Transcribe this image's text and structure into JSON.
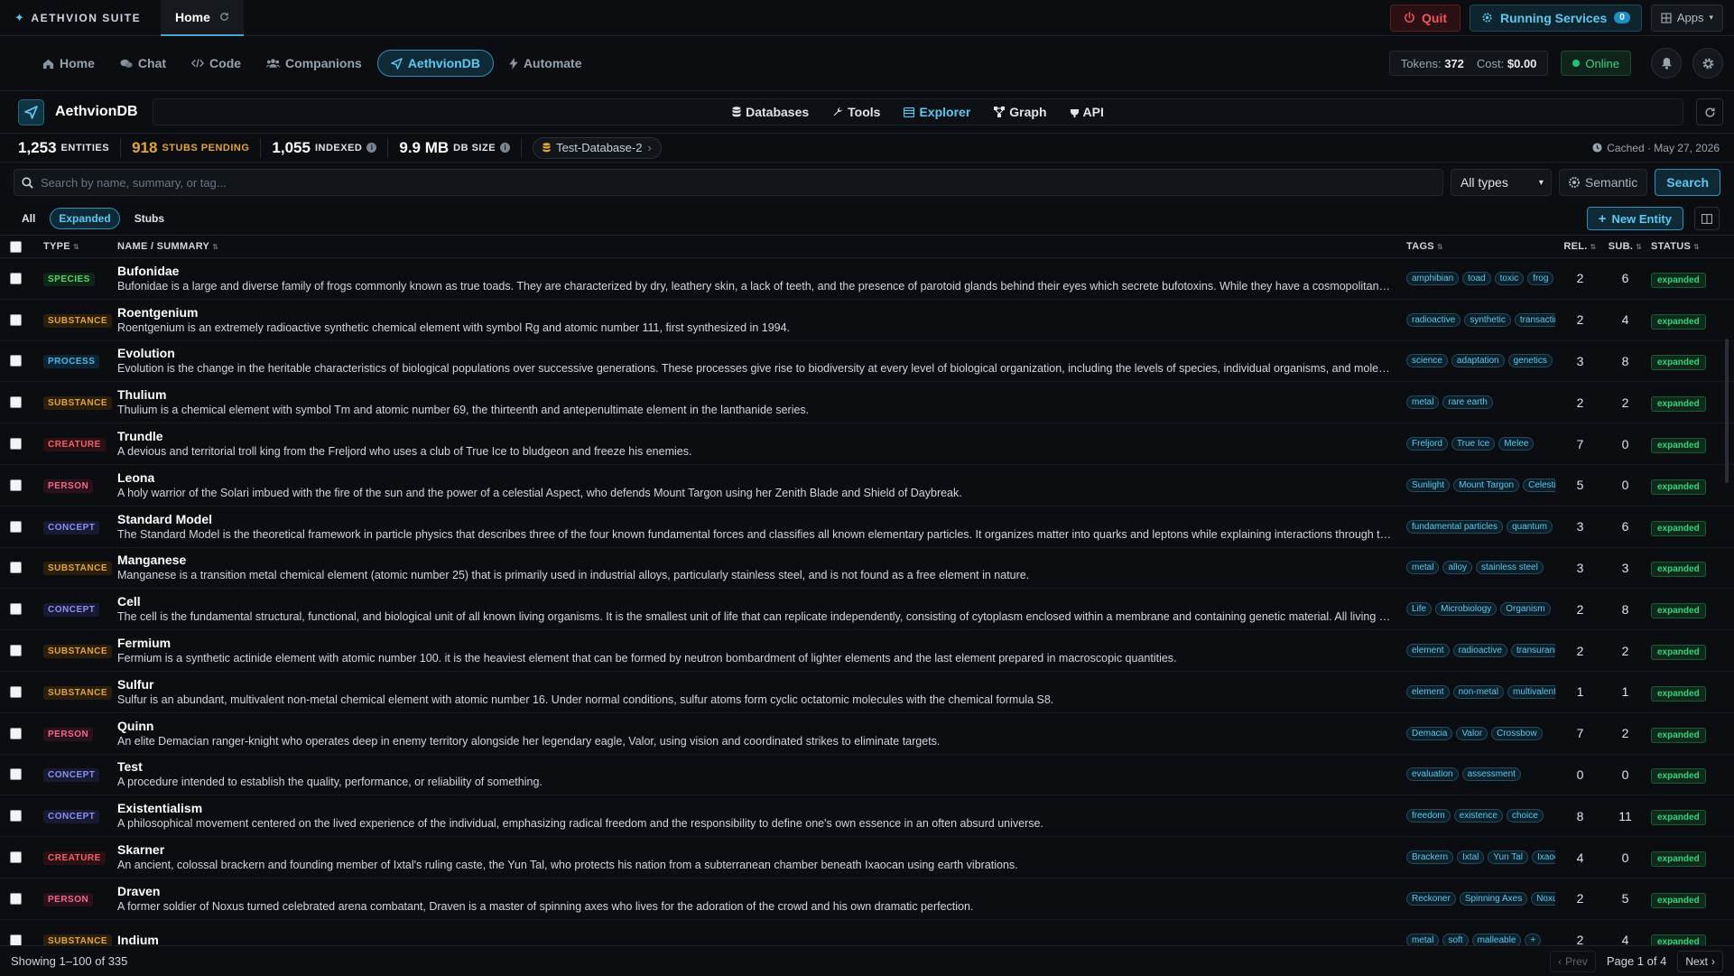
{
  "topbar": {
    "brand": "AETHVION SUITE",
    "tab_label": "Home",
    "quit_label": "Quit",
    "running_services_label": "Running Services",
    "running_services_count": "0",
    "apps_label": "Apps"
  },
  "nav": {
    "items": [
      {
        "label": "Home",
        "icon": "house-icon"
      },
      {
        "label": "Chat",
        "icon": "chat-icon"
      },
      {
        "label": "Code",
        "icon": "code-icon"
      },
      {
        "label": "Companions",
        "icon": "users-icon"
      },
      {
        "label": "AethvionDB",
        "icon": "send-icon"
      },
      {
        "label": "Automate",
        "icon": "bolt-icon"
      }
    ],
    "active": "AethvionDB",
    "tokens_label": "Tokens:",
    "tokens_value": "372",
    "cost_label": "Cost:",
    "cost_value": "$0.00",
    "status": "Online"
  },
  "db_header": {
    "title": "AethvionDB",
    "tabs": [
      "Databases",
      "Tools",
      "Explorer",
      "Graph",
      "API"
    ],
    "active_tab": "Explorer"
  },
  "metrics": {
    "entities_value": "1,253",
    "entities_label": "ENTITIES",
    "stubs_value": "918",
    "stubs_label": "STUBS PENDING",
    "indexed_value": "1,055",
    "indexed_label": "INDEXED",
    "size_value": "9.9 MB",
    "size_label": "DB SIZE",
    "database": "Test-Database-2",
    "cached": "Cached · May 27, 2026"
  },
  "search": {
    "placeholder": "Search by name, summary, or tag...",
    "type_filter": "All types",
    "semantic_label": "Semantic",
    "search_label": "Search"
  },
  "filters": {
    "pills": [
      "All",
      "Expanded",
      "Stubs"
    ],
    "active": "Expanded",
    "new_entity_label": "New Entity"
  },
  "table": {
    "headers": {
      "type": "TYPE",
      "name": "NAME / SUMMARY",
      "tags": "TAGS",
      "rel": "REL.",
      "sub": "SUB.",
      "status": "STATUS"
    },
    "rows": [
      {
        "type": "SPECIES",
        "name": "Bufonidae",
        "summary": "Bufonidae is a large and diverse family of frogs commonly known as true toads. They are characterized by dry, leathery skin, a lack of teeth, and the presence of parotoid glands behind their eyes which secrete bufotoxins. While they have a cosmopolitan distribution",
        "tags": [
          "amphibian",
          "toad",
          "toxic",
          "frog"
        ],
        "rel": "2",
        "sub": "6",
        "status": "expanded"
      },
      {
        "type": "SUBSTANCE",
        "name": "Roentgenium",
        "summary": "Roentgenium is an extremely radioactive synthetic chemical element with symbol Rg and atomic number 111, first synthesized in 1994.",
        "tags": [
          "radioactive",
          "synthetic",
          "transactinide"
        ],
        "rel": "2",
        "sub": "4",
        "status": "expanded"
      },
      {
        "type": "PROCESS",
        "name": "Evolution",
        "summary": "Evolution is the change in the heritable characteristics of biological populations over successive generations. These processes give rise to biodiversity at every level of biological organization, including the levels of species, individual organisms, and molecules",
        "tags": [
          "science",
          "adaptation",
          "genetics"
        ],
        "rel": "3",
        "sub": "8",
        "status": "expanded"
      },
      {
        "type": "SUBSTANCE",
        "name": "Thulium",
        "summary": "Thulium is a chemical element with symbol Tm and atomic number 69, the thirteenth and antepenultimate element in the lanthanide series.",
        "tags": [
          "metal",
          "rare earth"
        ],
        "rel": "2",
        "sub": "2",
        "status": "expanded"
      },
      {
        "type": "CREATURE",
        "name": "Trundle",
        "summary": "A devious and territorial troll king from the Freljord who uses a club of True Ice to bludgeon and freeze his enemies.",
        "tags": [
          "Freljord",
          "True Ice",
          "Melee"
        ],
        "rel": "7",
        "sub": "0",
        "status": "expanded"
      },
      {
        "type": "PERSON",
        "name": "Leona",
        "summary": "A holy warrior of the Solari imbued with the fire of the sun and the power of a celestial Aspect, who defends Mount Targon using her Zenith Blade and Shield of Daybreak.",
        "tags": [
          "Sunlight",
          "Mount Targon",
          "Celestial"
        ],
        "rel": "5",
        "sub": "0",
        "status": "expanded"
      },
      {
        "type": "CONCEPT",
        "name": "Standard Model",
        "summary": "The Standard Model is the theoretical framework in particle physics that describes three of the four known fundamental forces and classifies all known elementary particles. It organizes matter into quarks and leptons while explaining interactions through the exchange",
        "tags": [
          "fundamental particles",
          "quantum"
        ],
        "rel": "3",
        "sub": "6",
        "status": "expanded"
      },
      {
        "type": "SUBSTANCE",
        "name": "Manganese",
        "summary": "Manganese is a transition metal chemical element (atomic number 25) that is primarily used in industrial alloys, particularly stainless steel, and is not found as a free element in nature.",
        "tags": [
          "metal",
          "alloy",
          "stainless steel"
        ],
        "rel": "3",
        "sub": "3",
        "status": "expanded"
      },
      {
        "type": "CONCEPT",
        "name": "Cell",
        "summary": "The cell is the fundamental structural, functional, and biological unit of all known living organisms. It is the smallest unit of life that can replicate independently, consisting of cytoplasm enclosed within a membrane and containing genetic material. All living things",
        "tags": [
          "Life",
          "Microbiology",
          "Organism"
        ],
        "rel": "2",
        "sub": "8",
        "status": "expanded"
      },
      {
        "type": "SUBSTANCE",
        "name": "Fermium",
        "summary": "Fermium is a synthetic actinide element with atomic number 100. it is the heaviest element that can be formed by neutron bombardment of lighter elements and the last element prepared in macroscopic quantities.",
        "tags": [
          "element",
          "radioactive",
          "transuranic"
        ],
        "rel": "2",
        "sub": "2",
        "status": "expanded"
      },
      {
        "type": "SUBSTANCE",
        "name": "Sulfur",
        "summary": "Sulfur is an abundant, multivalent non-metal chemical element with atomic number 16. Under normal conditions, sulfur atoms form cyclic octatomic molecules with the chemical formula S8.",
        "tags": [
          "element",
          "non-metal",
          "multivalent"
        ],
        "rel": "1",
        "sub": "1",
        "status": "expanded"
      },
      {
        "type": "PERSON",
        "name": "Quinn",
        "summary": "An elite Demacian ranger-knight who operates deep in enemy territory alongside her legendary eagle, Valor, using vision and coordinated strikes to eliminate targets.",
        "tags": [
          "Demacia",
          "Valor",
          "Crossbow"
        ],
        "rel": "7",
        "sub": "2",
        "status": "expanded"
      },
      {
        "type": "CONCEPT",
        "name": "Test",
        "summary": "A procedure intended to establish the quality, performance, or reliability of something.",
        "tags": [
          "evaluation",
          "assessment"
        ],
        "rel": "0",
        "sub": "0",
        "status": "expanded"
      },
      {
        "type": "CONCEPT",
        "name": "Existentialism",
        "summary": "A philosophical movement centered on the lived experience of the individual, emphasizing radical freedom and the responsibility to define one's own essence in an often absurd universe.",
        "tags": [
          "freedom",
          "existence",
          "choice"
        ],
        "rel": "8",
        "sub": "11",
        "status": "expanded"
      },
      {
        "type": "CREATURE",
        "name": "Skarner",
        "summary": "An ancient, colossal brackern and founding member of Ixtal's ruling caste, the Yun Tal, who protects his nation from a subterranean chamber beneath Ixaocan using earth vibrations.",
        "tags": [
          "Brackern",
          "Ixtal",
          "Yun Tal",
          "Ixaocan"
        ],
        "rel": "4",
        "sub": "0",
        "status": "expanded"
      },
      {
        "type": "PERSON",
        "name": "Draven",
        "summary": "A former soldier of Noxus turned celebrated arena combatant, Draven is a master of spinning axes who lives for the adoration of the crowd and his own dramatic perfection.",
        "tags": [
          "Reckoner",
          "Spinning Axes",
          "Noxus"
        ],
        "rel": "2",
        "sub": "5",
        "status": "expanded"
      },
      {
        "type": "SUBSTANCE",
        "name": "Indium",
        "summary": "",
        "tags": [
          "metal",
          "soft",
          "malleable",
          "+"
        ],
        "rel": "2",
        "sub": "4",
        "status": "expanded"
      }
    ]
  },
  "footer": {
    "showing": "Showing 1–100 of 335",
    "prev_label": "Prev",
    "page_label": "Page 1 of 4",
    "next_label": "Next"
  }
}
